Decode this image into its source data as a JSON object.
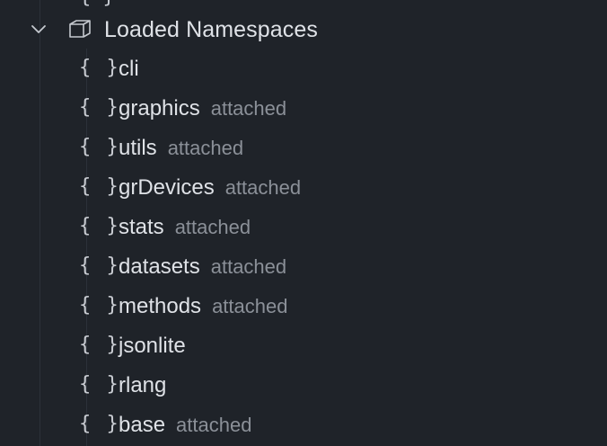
{
  "tree": {
    "clipped_item_brace": "{ }",
    "group": {
      "label": "Loaded Namespaces",
      "expanded": true,
      "chevron_icon": "chevron-down-icon",
      "group_icon": "package-cube-icon"
    },
    "items": [
      {
        "brace": "{ }",
        "name": "cli",
        "desc": ""
      },
      {
        "brace": "{ }",
        "name": "graphics",
        "desc": "attached"
      },
      {
        "brace": "{ }",
        "name": "utils",
        "desc": "attached"
      },
      {
        "brace": "{ }",
        "name": "grDevices",
        "desc": "attached"
      },
      {
        "brace": "{ }",
        "name": "stats",
        "desc": "attached"
      },
      {
        "brace": "{ }",
        "name": "datasets",
        "desc": "attached"
      },
      {
        "brace": "{ }",
        "name": "methods",
        "desc": "attached"
      },
      {
        "brace": "{ }",
        "name": "jsonlite",
        "desc": ""
      },
      {
        "brace": "{ }",
        "name": "rlang",
        "desc": ""
      },
      {
        "brace": "{ }",
        "name": "base",
        "desc": "attached"
      }
    ]
  },
  "colors": {
    "background": "#1f2329",
    "text": "#dfe2e7",
    "description": "#8b9098"
  }
}
